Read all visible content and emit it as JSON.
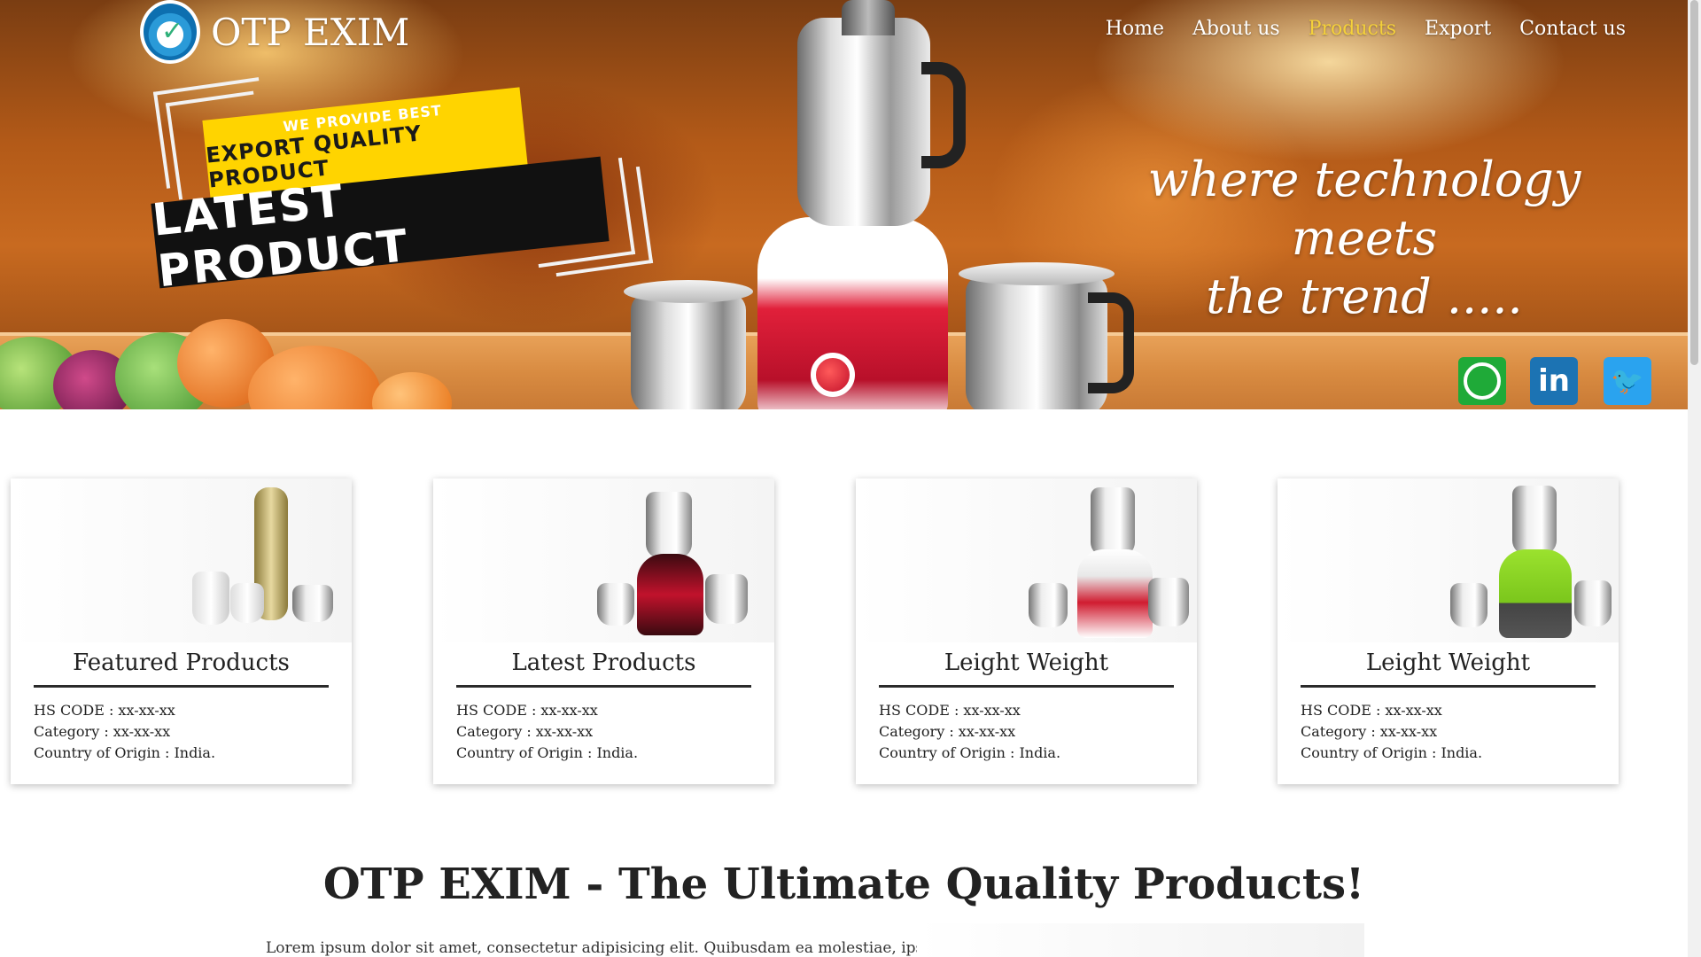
{
  "brand": {
    "name": "OTP EXIM"
  },
  "nav": {
    "items": [
      {
        "label": "Home",
        "active": false
      },
      {
        "label": "About us",
        "active": false
      },
      {
        "label": "Products",
        "active": true
      },
      {
        "label": "Export",
        "active": false
      },
      {
        "label": "Contact us",
        "active": false
      }
    ]
  },
  "hero": {
    "tag_small": "WE PROVIDE BEST",
    "tag_medium": "EXPORT QUALITY PRODUCT",
    "tag_large": "LATEST PRODUCT",
    "tagline_line1": "where technology meets",
    "tagline_line2": "the trend .....",
    "social": [
      {
        "icon": "whatsapp-icon",
        "label": ""
      },
      {
        "icon": "linkedin-icon",
        "label": "in"
      },
      {
        "icon": "twitter-icon",
        "label": "🐦"
      }
    ]
  },
  "cards": [
    {
      "title": "Featured Products",
      "hs_code": "HS CODE : xx-xx-xx",
      "category": "Category : xx-xx-xx",
      "origin": "Country of Origin : India."
    },
    {
      "title": "Latest Products",
      "hs_code": "HS CODE : xx-xx-xx",
      "category": "Category : xx-xx-xx",
      "origin": "Country of Origin : India."
    },
    {
      "title": "Leight Weight",
      "hs_code": "HS CODE : xx-xx-xx",
      "category": "Category : xx-xx-xx",
      "origin": "Country of Origin : India."
    },
    {
      "title": "Leight Weight",
      "hs_code": "HS CODE : xx-xx-xx",
      "category": "Category : xx-xx-xx",
      "origin": "Country of Origin : India."
    }
  ],
  "section": {
    "title": "OTP EXIM - The Ultimate Quality Products!",
    "body": "Lorem ipsum dolor sit amet, consectetur adipisicing elit. Quibusdam ea molestiae, ipsa,"
  },
  "colors": {
    "nav_active": "#f5d13a",
    "whatsapp": "#1faa38",
    "linkedin": "#1c73b3",
    "twitter": "#2aa3ef",
    "tag_yellow": "#ffd400"
  }
}
